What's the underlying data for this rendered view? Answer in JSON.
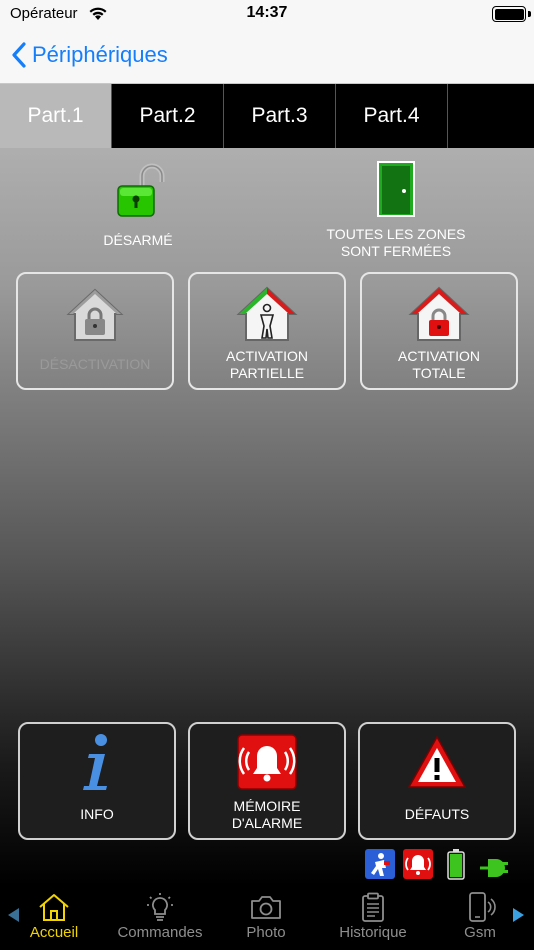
{
  "status_bar": {
    "carrier": "Opérateur",
    "time": "14:37"
  },
  "nav": {
    "back_label": "Périphériques"
  },
  "tabs": [
    {
      "label": "Part.1",
      "active": true
    },
    {
      "label": "Part.2"
    },
    {
      "label": "Part.3"
    },
    {
      "label": "Part.4"
    }
  ],
  "state": {
    "armed_label": "DÉSARMÉ",
    "zones_label_line1": "TOUTES LES ZONES",
    "zones_label_line2": "SONT FERMÉES"
  },
  "actions": {
    "deactivate_label": "DÉSACTIVATION",
    "partial_line1": "ACTIVATION",
    "partial_line2": "PARTIELLE",
    "total_line1": "ACTIVATION",
    "total_line2": "TOTALE"
  },
  "info_buttons": {
    "info_label": "INFO",
    "memory_line1": "MÉMOIRE",
    "memory_line2": "D'ALARME",
    "faults_label": "DÉFAUTS"
  },
  "tab_bar": {
    "items": [
      {
        "label": "Accueil",
        "icon": "home-icon",
        "active": true
      },
      {
        "label": "Commandes",
        "icon": "lightbulb-icon"
      },
      {
        "label": "Photo",
        "icon": "camera-icon"
      },
      {
        "label": "Historique",
        "icon": "clipboard-icon"
      },
      {
        "label": "Gsm",
        "icon": "phone-icon"
      }
    ]
  },
  "colors": {
    "accent_blue": "#147efb",
    "active_tab_yellow": "#f2d400",
    "lock_green": "#27c400",
    "alarm_red": "#e01010"
  }
}
